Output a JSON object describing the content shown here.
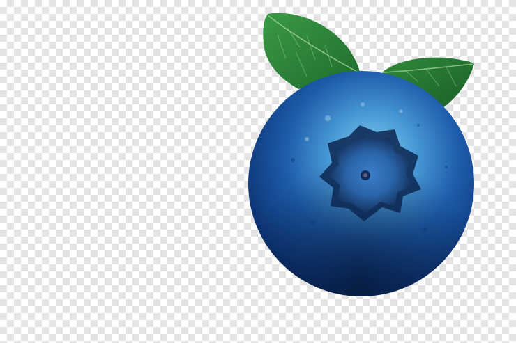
{
  "image": {
    "subject": "blueberry-with-leaves",
    "background": "transparency-checkerboard",
    "colors": {
      "checker_light": "#ffffff",
      "checker_dark": "#e3e3e3",
      "berry_deep": "#0b2f66",
      "berry_mid": "#1f5fae",
      "berry_light": "#7ec3e6",
      "leaf_green": "#2f8a3a",
      "leaf_dark": "#1f6b2c"
    }
  }
}
